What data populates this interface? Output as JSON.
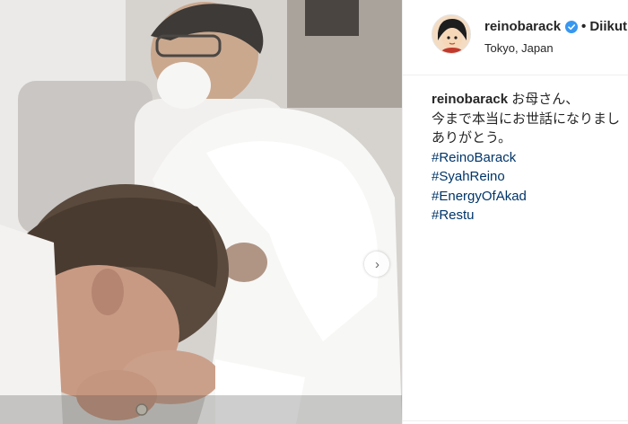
{
  "post": {
    "username": "reinobarack",
    "dot": "•",
    "follow_label": "Diikuti",
    "location": "Tokyo, Japan"
  },
  "caption": {
    "username": "reinobarack",
    "lines": [
      "お母さん、",
      "今まで本当にお世話になりまし",
      "ありがとう。"
    ],
    "hashtags": [
      "#ReinoBarack",
      "#SyahReino",
      "#EnergyOfAkad",
      "#Restu"
    ]
  },
  "colors": {
    "text": "#262626",
    "hashtag": "#003569",
    "verified": "#3897f0"
  },
  "icons": {
    "verified": "verified-badge-icon",
    "carousel": "chevron-right-icon"
  }
}
